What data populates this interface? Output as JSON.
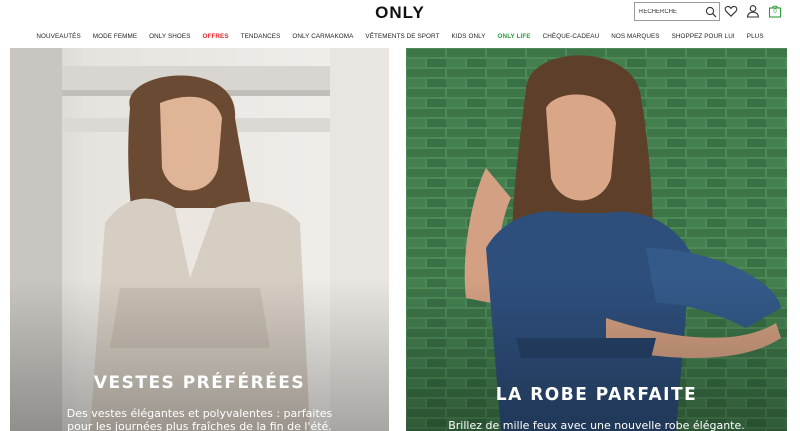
{
  "header": {
    "logo": "ONLY",
    "search_placeholder": "RECHERCHE",
    "cart_count": "0"
  },
  "nav": {
    "items": [
      {
        "label": "NOUVEAUTÉS",
        "style": "normal"
      },
      {
        "label": "MODE FEMME",
        "style": "normal"
      },
      {
        "label": "ONLY SHOES",
        "style": "normal"
      },
      {
        "label": "OFFRES",
        "style": "red"
      },
      {
        "label": "TENDANCES",
        "style": "normal"
      },
      {
        "label": "ONLY CARMAKOMA",
        "style": "normal"
      },
      {
        "label": "VÊTEMENTS DE SPORT",
        "style": "normal"
      },
      {
        "label": "KIDS ONLY",
        "style": "normal"
      },
      {
        "label": "ONLY LIFE",
        "style": "green"
      },
      {
        "label": "CHÈQUE-CADEAU",
        "style": "normal"
      },
      {
        "label": "NOS MARQUES",
        "style": "normal"
      },
      {
        "label": "SHOPPEZ POUR LUI",
        "style": "normal"
      },
      {
        "label": "PLUS",
        "style": "normal"
      }
    ]
  },
  "panels": {
    "left": {
      "title": "VESTES PRÉFÉRÉES",
      "subtitle_line1": "Des vestes élégantes et polyvalentes : parfaites",
      "subtitle_line2": "pour les journées plus fraîches de la fin de l'été."
    },
    "right": {
      "title": "LA ROBE PARFAITE",
      "subtitle_line1": "Brillez de mille feux avec une nouvelle robe élégante."
    }
  },
  "colors": {
    "accent_red": "#e3262d",
    "accent_green": "#2f9a3a",
    "brick_green": "#3f7a4a",
    "denim": "#2e4f7c"
  }
}
